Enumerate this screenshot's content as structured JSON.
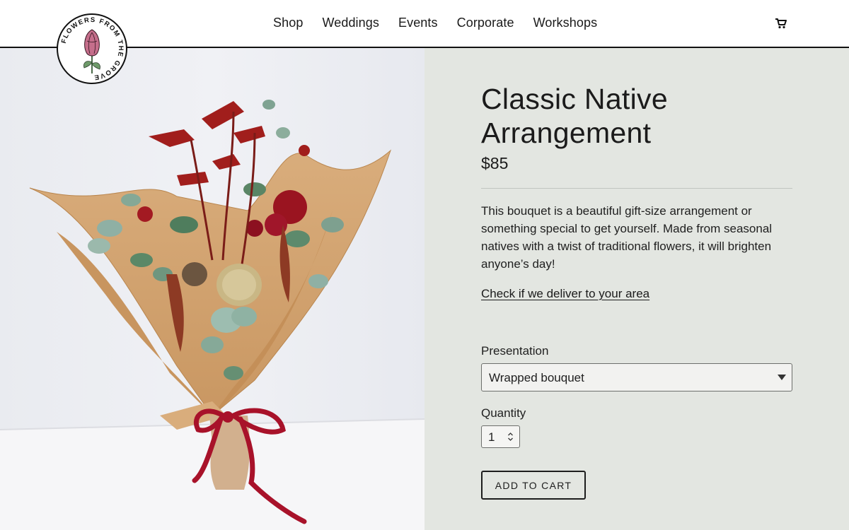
{
  "brand": {
    "logo_text": "FLOWERS FROM THE GROVE",
    "logo_icon": "protea-flower-icon"
  },
  "nav": {
    "items": [
      {
        "label": "Shop"
      },
      {
        "label": "Weddings"
      },
      {
        "label": "Events"
      },
      {
        "label": "Corporate"
      },
      {
        "label": "Workshops"
      }
    ],
    "cart_icon": "cart-icon"
  },
  "product": {
    "title": "Classic Native Arrangement",
    "price": "$85",
    "description": "This bouquet is a beautiful gift-size arrangement or something special to get yourself. Made from seasonal natives with a twist of traditional flowers, it will brighten anyone’s day!",
    "delivery_link": "Check if we deliver to your area",
    "image": "bouquet-photo"
  },
  "options": {
    "presentation_label": "Presentation",
    "presentation_value": "Wrapped bouquet",
    "quantity_label": "Quantity",
    "quantity_value": "1"
  },
  "actions": {
    "add_to_cart": "ADD TO CART"
  },
  "colors": {
    "header_bg": "#ffffff",
    "panel_bg": "#e3e6e1",
    "text": "#1b1b1b",
    "ribbon": "#a8122a"
  }
}
